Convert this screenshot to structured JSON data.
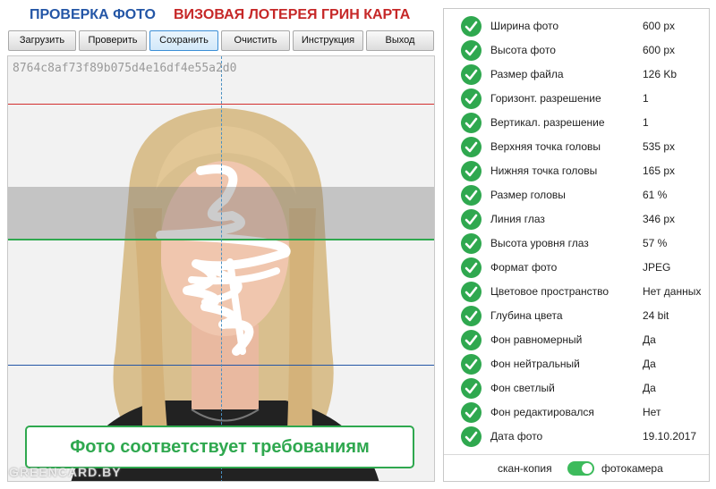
{
  "header": {
    "title_primary": "ПРОВЕРКА ФОТО",
    "title_secondary": "ВИЗОВАЯ ЛОТЕРЕЯ ГРИН КАРТА"
  },
  "toolbar": {
    "buttons": [
      {
        "label": "Загрузить"
      },
      {
        "label": "Проверить"
      },
      {
        "label": "Сохранить"
      },
      {
        "label": "Очистить"
      },
      {
        "label": "Инструкция"
      },
      {
        "label": "Выход"
      }
    ]
  },
  "photo": {
    "hash": "8764c8af73f89b075d4e16df4e55a2d0",
    "result_text": "Фото соответствует требованиям",
    "watermark": "GREENCARD.BY",
    "guide_colors": {
      "top": "#d32f2f",
      "eyes": "#2fa84f",
      "chin": "#2456a6",
      "center": "#4a90c2"
    }
  },
  "checks": {
    "items": [
      {
        "label": "Ширина фото",
        "value": "600 px"
      },
      {
        "label": "Высота фото",
        "value": "600 px"
      },
      {
        "label": "Размер файла",
        "value": "126 Kb"
      },
      {
        "label": "Горизонт. разрешение",
        "value": "1"
      },
      {
        "label": "Вертикал. разрешение",
        "value": "1"
      },
      {
        "label": "Верхняя точка головы",
        "value": "535 px"
      },
      {
        "label": "Нижняя точка головы",
        "value": "165 px"
      },
      {
        "label": "Размер головы",
        "value": "61 %"
      },
      {
        "label": "Линия глаз",
        "value": "346 px"
      },
      {
        "label": "Высота уровня глаз",
        "value": "57 %"
      },
      {
        "label": "Формат фото",
        "value": "JPEG"
      },
      {
        "label": "Цветовое пространство",
        "value": "Нет данных"
      },
      {
        "label": "Глубина цвета",
        "value": "24 bit"
      },
      {
        "label": "Фон равномерный",
        "value": "Да"
      },
      {
        "label": "Фон нейтральный",
        "value": "Да"
      },
      {
        "label": "Фон светлый",
        "value": "Да"
      },
      {
        "label": "Фон редактировался",
        "value": "Нет"
      },
      {
        "label": "Дата фото",
        "value": "19.10.2017"
      }
    ],
    "status_color": "#2fa84f"
  },
  "source_toggle": {
    "left_label": "скан-копия",
    "right_label": "фотокамера",
    "selected": "фотокамера"
  }
}
